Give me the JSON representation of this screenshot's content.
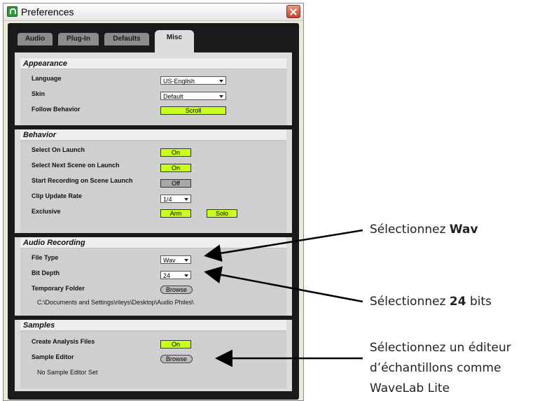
{
  "window": {
    "title": "Preferences"
  },
  "tabs": [
    "Audio",
    "Plug-In",
    "Defaults",
    "Misc"
  ],
  "appearance": {
    "title": "Appearance",
    "language_label": "Language",
    "language_value": "US-English",
    "skin_label": "Skin",
    "skin_value": "Default",
    "follow_label": "Follow Behavior",
    "follow_value": "Scroll"
  },
  "behavior": {
    "title": "Behavior",
    "select_launch_label": "Select On Launch",
    "select_launch_value": "On",
    "select_next_label": "Select Next Scene on Launch",
    "select_next_value": "On",
    "start_rec_label": "Start Recording on Scene Launch",
    "start_rec_value": "Off",
    "clip_rate_label": "Clip Update Rate",
    "clip_rate_value": "1/4",
    "exclusive_label": "Exclusive",
    "arm_label": "Arm",
    "solo_label": "Solo"
  },
  "audio_recording": {
    "title": "Audio Recording",
    "file_type_label": "File Type",
    "file_type_value": "Wav",
    "bit_depth_label": "Bit Depth",
    "bit_depth_value": "24",
    "temp_folder_label": "Temporary Folder",
    "browse_label": "Browse",
    "temp_folder_path": "C:\\Documents and Settings\\rileys\\Desktop\\Audio Philes\\"
  },
  "samples": {
    "title": "Samples",
    "create_analysis_label": "Create Analysis Files",
    "create_analysis_value": "On",
    "sample_editor_label": "Sample Editor",
    "browse_label": "Browse",
    "sample_editor_status": "No Sample Editor Set"
  },
  "annotations": {
    "wav_prefix": "Sélectionnez ",
    "wav_bold": "Wav",
    "bits_prefix": "Sélectionnez ",
    "bits_bold": "24",
    "bits_suffix": " bits",
    "editor_line1": "Sélectionnez un éditeur",
    "editor_line2": "d’échantillons comme",
    "editor_line3": "WaveLab Lite"
  }
}
